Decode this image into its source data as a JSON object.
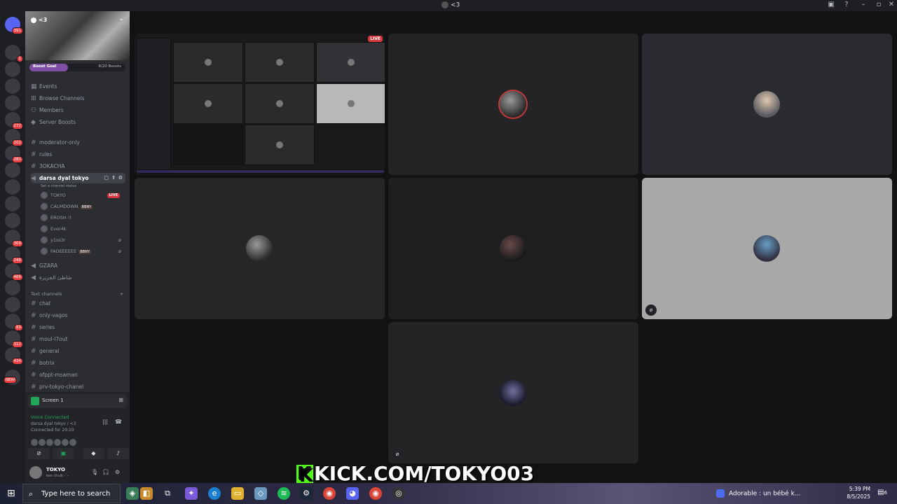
{
  "window": {
    "title": "<3"
  },
  "guilds": [
    {
      "badge": "391"
    },
    {
      "badge": "1"
    },
    {
      "badge": ""
    },
    {
      "badge": ""
    },
    {
      "badge": ""
    },
    {
      "badge": "272"
    },
    {
      "badge": "102"
    },
    {
      "badge": "280"
    },
    {
      "badge": ""
    },
    {
      "badge": ""
    },
    {
      "badge": ""
    },
    {
      "badge": ""
    },
    {
      "badge": "309"
    },
    {
      "badge": "248"
    },
    {
      "badge": "466"
    },
    {
      "badge": ""
    },
    {
      "badge": ""
    },
    {
      "badge": "89"
    },
    {
      "badge": "312"
    },
    {
      "badge": "434"
    },
    {
      "badge": "NEW"
    }
  ],
  "server": {
    "name": "<3"
  },
  "boost": {
    "label": "Boost Goal",
    "count": "8/20 Boosts",
    "progress": 0.4
  },
  "nav": [
    {
      "icon": "calendar-icon",
      "label": "Events"
    },
    {
      "icon": "browse-icon",
      "label": "Browse Channels"
    },
    {
      "icon": "members-icon",
      "label": "Members"
    },
    {
      "icon": "boost-icon",
      "label": "Server Boosts"
    }
  ],
  "channels_top": [
    {
      "label": "moderator-only"
    },
    {
      "label": "rules"
    },
    {
      "label": "3OKACHA"
    }
  ],
  "voice_active": {
    "label": "darsa dyal tokyo",
    "status": "Set a channel status"
  },
  "voice_users": [
    {
      "name": "TOKYO",
      "live": "LIVE",
      "tag": ""
    },
    {
      "name": "CALMDOWN",
      "live": "",
      "tag": "BBNY"
    },
    {
      "name": "EROSH !!",
      "live": "",
      "tag": ""
    },
    {
      "name": "Ever4k",
      "live": "",
      "tag": ""
    },
    {
      "name": "y1ss3r",
      "live": "",
      "tag": ""
    },
    {
      "name": "FADEEEEEE",
      "live": "",
      "tag": "BBNY"
    }
  ],
  "voice_channels": [
    {
      "label": "GZARA"
    },
    {
      "label": "شاطئ الجزيرة"
    }
  ],
  "text_category": "Text channels",
  "text_channels": [
    {
      "label": "chat"
    },
    {
      "label": "only-vagos"
    },
    {
      "label": "series"
    },
    {
      "label": "moul-l7out"
    },
    {
      "label": "general"
    },
    {
      "label": "botrix"
    },
    {
      "label": "ofppt-msaman"
    },
    {
      "label": "prv-tokyo-chanel"
    }
  ],
  "panel": {
    "screen_label": "Screen 1",
    "voice_status": "Voice Connected",
    "voice_channel": "darsa dyal tokyo / <3",
    "connected_for": "Connected for 20:10"
  },
  "user": {
    "name": "TOKYO",
    "status": "ken chulk -`-"
  },
  "stream": {
    "live": "LIVE"
  },
  "overlay": {
    "k": "K",
    "text": "KICK.COM/TOKYO03"
  },
  "taskbar": {
    "search_placeholder": "Type here to search",
    "news": "Adorable : un bébé k...",
    "time": "5:39 PM",
    "date": "8/5/2025",
    "notif_count": "6"
  },
  "colors": {
    "accent": "#5865f2",
    "live": "#da373c",
    "online": "#23a55a",
    "kick": "#53fc18"
  }
}
